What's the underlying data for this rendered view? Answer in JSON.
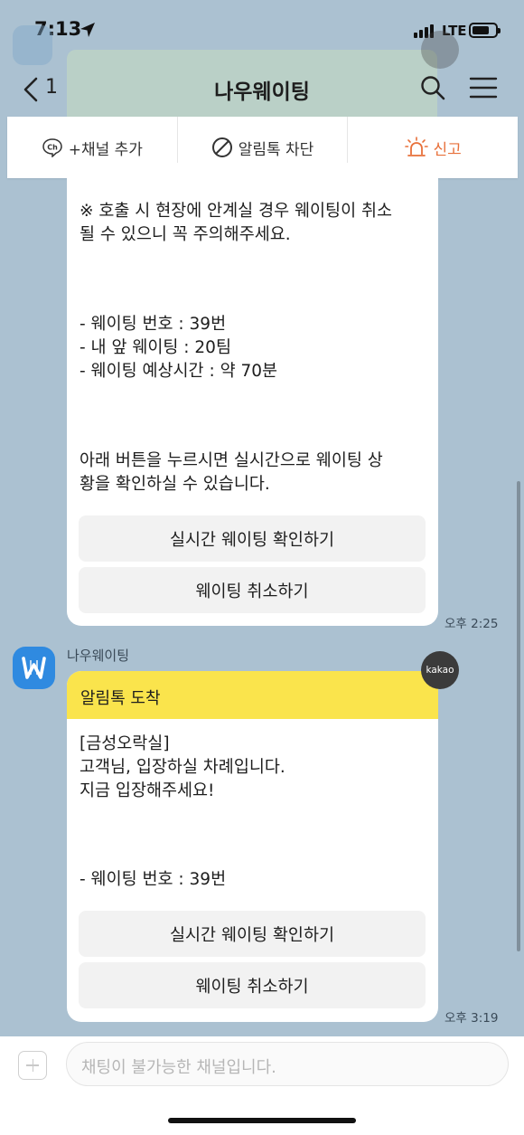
{
  "status": {
    "time": "7:13",
    "network": "LTE"
  },
  "header": {
    "back_count": "1",
    "title": "나우웨이팅"
  },
  "actions": [
    {
      "label": "+채널 추가",
      "icon": "channel-icon"
    },
    {
      "label": "알림톡 차단",
      "icon": "block-icon"
    },
    {
      "label": "신고",
      "icon": "siren-icon"
    }
  ],
  "message1": {
    "notice": "※ 호출 시 현장에 안계실 경우 웨이팅이 취소\n될 수 있으니 꼭 주의해주세요.",
    "details": "- 웨이팅 번호 : 39번\n- 내 앞 웨이팅 : 20팀\n- 웨이팅 예상시간 : 약 70분",
    "guide": "아래 버튼을 누르시면 실시간으로 웨이팅 상\n황을 확인하실 수 있습니다.",
    "button_check": "실시간 웨이팅 확인하기",
    "button_cancel": "웨이팅 취소하기",
    "time": "오후 2:25"
  },
  "message2": {
    "sender": "나우웨이팅",
    "badge": "kakao",
    "header": "알림톡 도착",
    "body": "[금성오락실]\n고객님, 입장하실 차례입니다.\n지금 입장해주세요!",
    "details": "- 웨이팅 번호 : 39번",
    "button_check": "실시간 웨이팅 확인하기",
    "button_cancel": "웨이팅 취소하기",
    "time": "오후 3:19"
  },
  "input": {
    "placeholder": "채팅이 불가능한 채널입니다."
  },
  "colors": {
    "background": "#abc1d1",
    "alimtalk_header": "#fae44c",
    "report": "#e8703a",
    "avatar": "#2f8ae0"
  }
}
